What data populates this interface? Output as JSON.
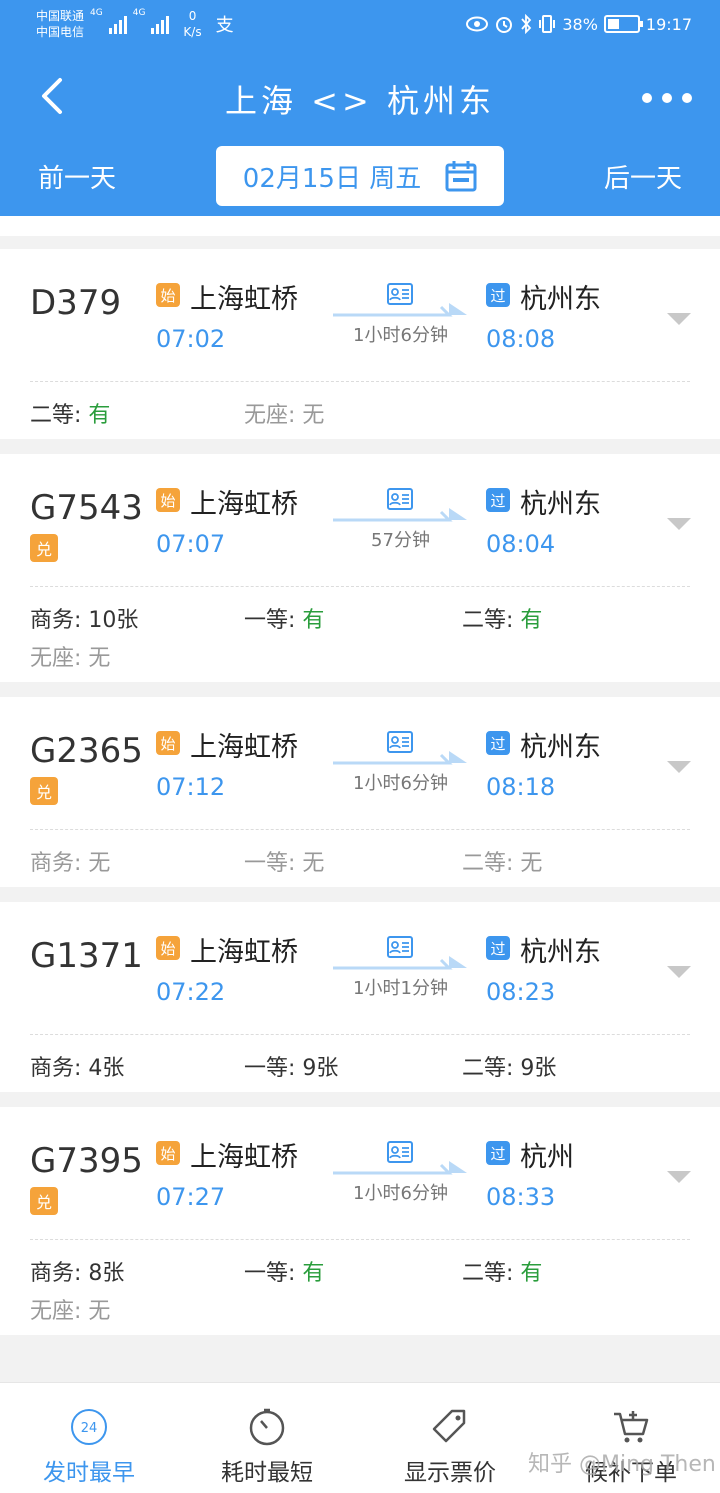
{
  "status_bar": {
    "carrier1": "中国联通",
    "carrier2": "中国电信",
    "net1": "4G",
    "net2": "4G",
    "speed_value": "0",
    "speed_unit": "K/s",
    "pay_icon": "alipay-icon",
    "battery": "38%",
    "battery_level": 0.38,
    "time": "19:17"
  },
  "nav": {
    "title": "上海 <> 杭州东",
    "back_icon": "chevron-left-icon",
    "more_icon": "more-dots-icon"
  },
  "date_bar": {
    "prev": "前一天",
    "date": "02月15日 周五",
    "next": "后一天",
    "calendar_icon": "calendar-icon"
  },
  "trains": [
    {
      "no": "D379",
      "dui": "",
      "from_tag": "始",
      "from": "上海虹桥",
      "dep": "07:02",
      "duration": "1小时6分钟",
      "to_tag": "过",
      "to": "杭州东",
      "arr": "08:08",
      "seats": [
        {
          "label": "二等: ",
          "value": "有"
        },
        {
          "label": "无座: ",
          "value": "无"
        }
      ]
    },
    {
      "no": "G7543",
      "dui": "兑",
      "from_tag": "始",
      "from": "上海虹桥",
      "dep": "07:07",
      "duration": "57分钟",
      "to_tag": "过",
      "to": "杭州东",
      "arr": "08:04",
      "seats": [
        {
          "label": "商务: ",
          "value": "10张"
        },
        {
          "label": "一等: ",
          "value": "有"
        },
        {
          "label": "二等: ",
          "value": "有"
        },
        {
          "label": "无座: ",
          "value": "无"
        }
      ]
    },
    {
      "no": "G2365",
      "dui": "兑",
      "from_tag": "始",
      "from": "上海虹桥",
      "dep": "07:12",
      "duration": "1小时6分钟",
      "to_tag": "过",
      "to": "杭州东",
      "arr": "08:18",
      "seats": [
        {
          "label": "商务: ",
          "value": "无"
        },
        {
          "label": "一等: ",
          "value": "无"
        },
        {
          "label": "二等: ",
          "value": "无"
        }
      ]
    },
    {
      "no": "G1371",
      "dui": "",
      "from_tag": "始",
      "from": "上海虹桥",
      "dep": "07:22",
      "duration": "1小时1分钟",
      "to_tag": "过",
      "to": "杭州东",
      "arr": "08:23",
      "seats": [
        {
          "label": "商务: ",
          "value": "4张"
        },
        {
          "label": "一等: ",
          "value": "9张"
        },
        {
          "label": "二等: ",
          "value": "9张"
        }
      ]
    },
    {
      "no": "G7395",
      "dui": "兑",
      "from_tag": "始",
      "from": "上海虹桥",
      "dep": "07:27",
      "duration": "1小时6分钟",
      "to_tag": "过",
      "to": "杭州",
      "arr": "08:33",
      "seats": [
        {
          "label": "商务: ",
          "value": "8张"
        },
        {
          "label": "一等: ",
          "value": "有"
        },
        {
          "label": "二等: ",
          "value": "有"
        },
        {
          "label": "无座: ",
          "value": "无"
        }
      ]
    }
  ],
  "bottom_bar": {
    "earliest": "发时最早",
    "earliest_icon_text": "24",
    "shortest": "耗时最短",
    "price": "显示票价",
    "waitlist": "候补下单"
  },
  "watermark": "知乎 @Ming Then",
  "colors": {
    "brand_blue": "#3d96ee",
    "tag_orange": "#f5a33a",
    "available_green": "#2a9d3c",
    "background": "#f2f2f2"
  }
}
